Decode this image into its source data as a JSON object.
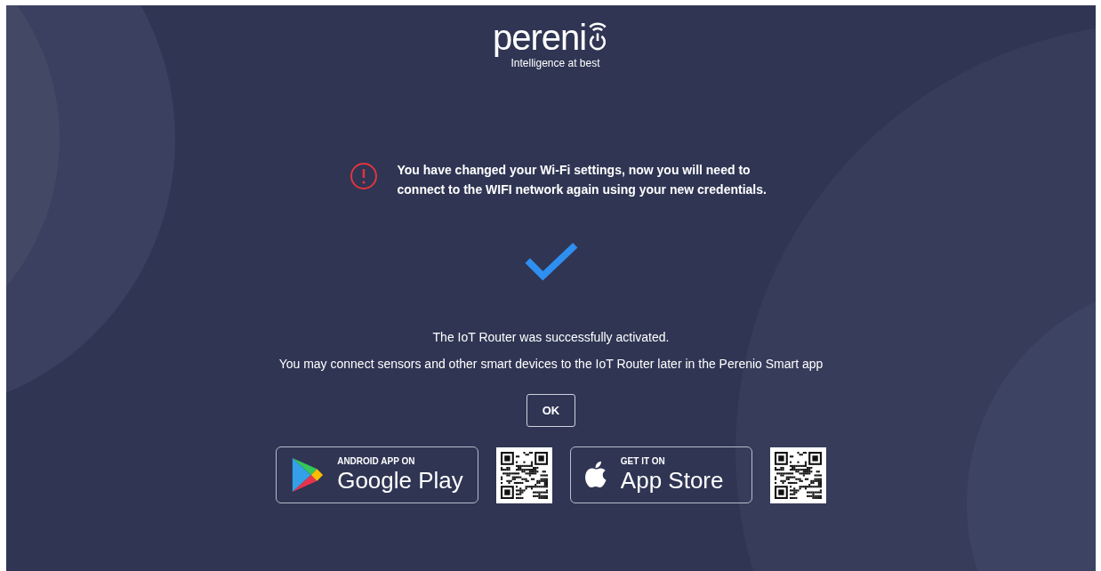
{
  "logo": {
    "wordmark": "pereni",
    "tagline": "Intelligence at best"
  },
  "warning": {
    "message": "You have changed your Wi-Fi settings, now you will need to connect to the WIFI network again using your new credentials."
  },
  "status": {
    "lines": [
      "The IoT Router was successfully activated.",
      "You may connect sensors and other smart devices to the IoT Router later in the Perenio Smart app"
    ]
  },
  "ok_button": "OK",
  "stores": [
    {
      "kind": "google",
      "caption": "ANDROID APP ON",
      "name": "Google Play"
    },
    {
      "kind": "apple",
      "caption": "GET IT ON",
      "name": "App Store"
    }
  ]
}
